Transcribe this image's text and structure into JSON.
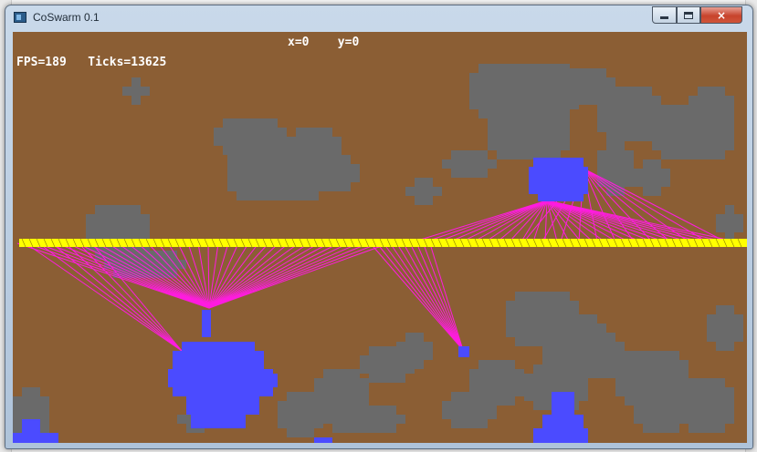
{
  "window": {
    "title": "CoSwarm 0.1",
    "buttons": {
      "minimize": "minimize",
      "maximize": "maximize",
      "close": "×"
    }
  },
  "hud": {
    "x_label": "x=0",
    "y_label": "y=0",
    "fps_label": "FPS=189",
    "ticks_label": "Ticks=13625"
  },
  "colors": {
    "ground": "#8b5e34",
    "rock": "#6a6a6a",
    "swarm": "#4b4bff",
    "beam": "#ff1ce0",
    "bar": "#ffff00"
  }
}
